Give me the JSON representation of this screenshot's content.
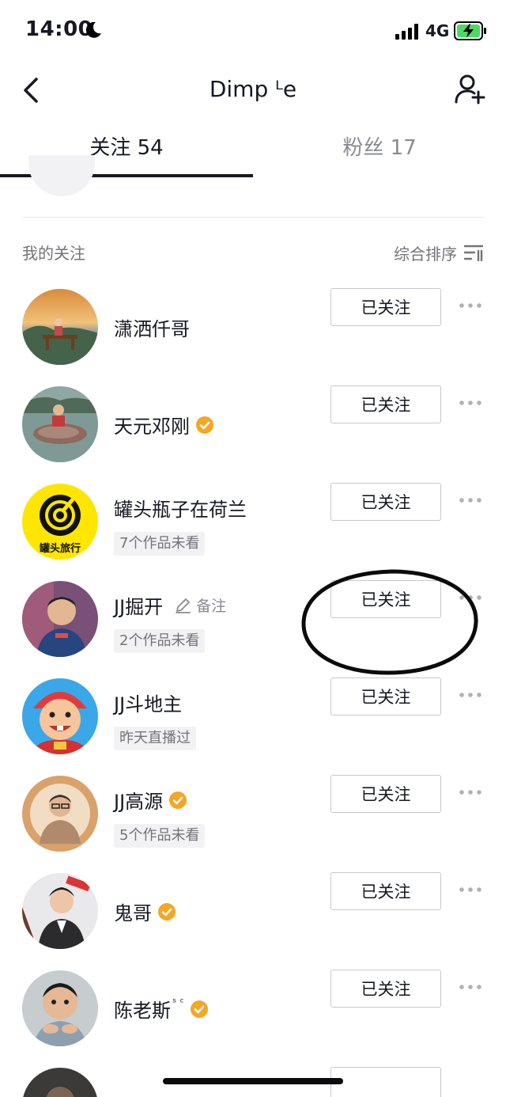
{
  "status_bar": {
    "time": "14:00",
    "network": "4G"
  },
  "nav": {
    "title": "Dimp ᴸe"
  },
  "tabs": {
    "following": "关注 54",
    "fans": "粉丝 17"
  },
  "section": {
    "title": "我的关注",
    "sort_label": "综合排序"
  },
  "users": [
    {
      "name": "潇洒仟哥",
      "verified": false,
      "sub": "",
      "follow_label": "已关注"
    },
    {
      "name": "天元邓刚",
      "verified": true,
      "sub": "",
      "follow_label": "已关注"
    },
    {
      "name": "罐头瓶子在荷兰",
      "verified": false,
      "sub": "7个作品未看",
      "follow_label": "已关注",
      "avatar_text": "罐头旅行"
    },
    {
      "name": "JJ掘开",
      "verified": false,
      "remark": "备注",
      "sub": "2个作品未看",
      "follow_label": "已关注"
    },
    {
      "name": "JJ斗地主",
      "verified": false,
      "sub": "昨天直播过",
      "follow_label": "已关注"
    },
    {
      "name": "JJ高源",
      "verified": true,
      "sub": "5个作品未看",
      "follow_label": "已关注"
    },
    {
      "name": "鬼哥",
      "verified": true,
      "sub": "",
      "follow_label": "已关注"
    },
    {
      "name": "陈老斯",
      "sup": "ˢ ᶜ",
      "verified": true,
      "sub": "",
      "follow_label": "已关注"
    }
  ],
  "colors": {
    "verified": "#F5A623",
    "text": "#161823",
    "muted": "#8a8b91"
  }
}
